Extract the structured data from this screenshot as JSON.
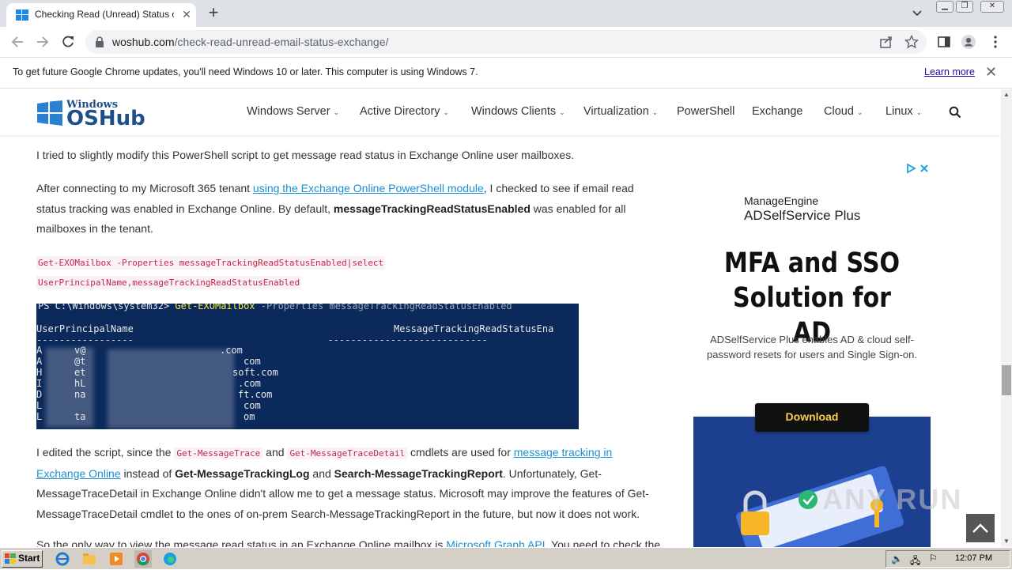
{
  "browser": {
    "tab_title": "Checking Read (Unread) Status of E",
    "url_host": "woshub.com",
    "url_path": "/check-read-unread-email-status-exchange/"
  },
  "infobar": {
    "message": "To get future Google Chrome updates, you'll need Windows 10 or later. This computer is using Windows 7.",
    "learn_more": "Learn more"
  },
  "site": {
    "logo_small": "Windows",
    "logo_big": "OSHub",
    "nav": [
      {
        "label": "Windows Server",
        "has_menu": true
      },
      {
        "label": "Active Directory",
        "has_menu": true
      },
      {
        "label": "Windows Clients",
        "has_menu": true
      },
      {
        "label": "Virtualization",
        "has_menu": true
      },
      {
        "label": "PowerShell",
        "has_menu": false
      },
      {
        "label": "Exchange",
        "has_menu": false
      },
      {
        "label": "Cloud",
        "has_menu": true
      },
      {
        "label": "Linux",
        "has_menu": true
      }
    ]
  },
  "article": {
    "p1": "I tried to slightly modify this PowerShell script to get message read status in Exchange Online user mailboxes.",
    "p2": {
      "before_link": "After connecting to my Microsoft 365 tenant ",
      "link": "using the Exchange Online PowerShell module",
      "after_link": ", I checked to see if email read status tracking was enabled in Exchange Online. By default, ",
      "bold": "messageTrackingReadStatusEnabled",
      "end": " was enabled for all mailboxes in the tenant."
    },
    "code_line1": "Get-EXOMailbox -Properties messageTrackingReadStatusEnabled|select",
    "code_line2": "UserPrincipalName,messageTrackingReadStatusEnabled",
    "screenshot": {
      "prompt": "PS C:\\Windows\\system32> ",
      "command": "Get-EXOMailbox",
      "rest": " -Properties messageTrackingReadStatusEnabled",
      "col1": "UserPrincipalName",
      "col2": "MessageTrackingReadStatusEna",
      "rows": [
        {
          "start": "A",
          "end": ".com"
        },
        {
          "start": "A",
          "end": "com"
        },
        {
          "start": "H",
          "end": "soft.com"
        },
        {
          "start": "I",
          "end": ".com"
        },
        {
          "start": "D",
          "end": "ft.com"
        },
        {
          "start": "L",
          "end": "com"
        },
        {
          "start": "L",
          "end": "om"
        }
      ],
      "row_fragments": [
        "v@",
        "@t",
        "et",
        "hL",
        "na",
        "ta"
      ]
    },
    "p3": {
      "t1": "I edited the script, since the ",
      "c1": "Get-MessageTrace",
      "t2": " and ",
      "c2": "Get-MessageTraceDetail",
      "t3": " cmdlets are used for ",
      "link": "message tracking in Exchange Online",
      "t4": " instead of ",
      "b1": "Get-MessageTrackingLog",
      "t5": " and ",
      "b2": "Search-MessageTrackingReport",
      "t6": ". Unfortunately, Get-MessageTraceDetail in Exchange Online didn't allow me to get a message status. Microsoft may improve the features of Get-MessageTraceDetail cmdlet to the ones of on-prem Search-MessageTrackingReport in the future, but now it does not work."
    },
    "p4": {
      "t1": "So the only way to view the message read status in an Exchange Online mailbox is ",
      "link": "Microsoft Graph API",
      "t2": ". You need to check the"
    }
  },
  "ad": {
    "brand_line1": "ManageEngine",
    "brand_line2": "ADSelfService Plus",
    "headline_line1": "MFA and SSO",
    "headline_line2": "Solution for AD",
    "desc_line1": "ADSelfService Plus enables AD & cloud self-",
    "desc_line2": "password resets for users and Single Sign-on.",
    "button": "Download"
  },
  "watermark": "ANY RUN",
  "taskbar": {
    "start": "Start",
    "clock": "12:07 PM"
  },
  "colors": {
    "link": "#1a8fd1",
    "code": "#c7254e",
    "logo": "#1f4f8a",
    "ps_bg": "#0b2a5b",
    "ad_image": "#1d3f8f"
  }
}
